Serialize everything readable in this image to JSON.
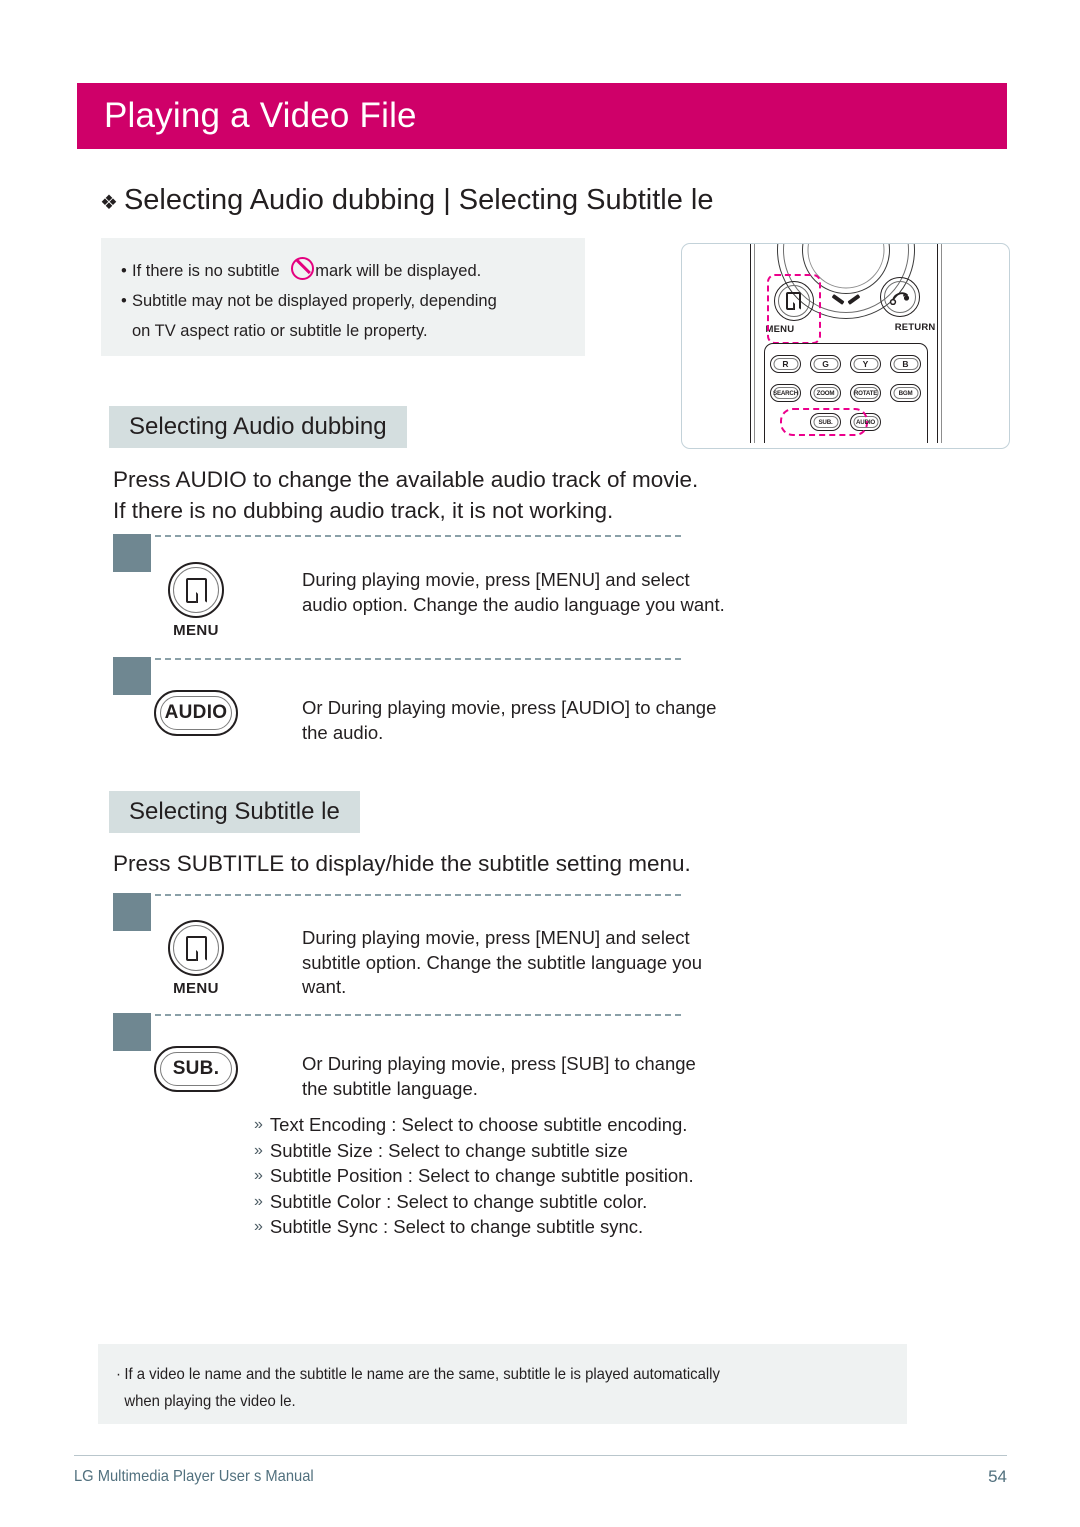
{
  "page": {
    "title": "Playing a Video File",
    "heading_bullet": "❖",
    "heading": "Selecting Audio dubbing | Selecting Subtitle  le"
  },
  "note_top": {
    "bullet": "•",
    "line1_before": "If there is no subtitle",
    "no_symbol_icon": "no-symbol-icon",
    "line1_after": "mark will be displayed.",
    "line2": "Subtitle may not be displayed properly, depending",
    "line3": "on TV aspect ratio or subtitle  le property."
  },
  "remote": {
    "menu_label": "MENU",
    "return_label": "RETURN",
    "color_keys": [
      "R",
      "G",
      "Y",
      "B"
    ],
    "function_keys": [
      "SEARCH",
      "ZOOM",
      "ROTATE",
      "BGM"
    ],
    "media_keys": [
      "SUB.",
      "AUDIO"
    ],
    "highlight_color": "#ec008c",
    "frame_border_color": "#c3d2d9"
  },
  "audio_section": {
    "chip": "Selecting Audio dubbing",
    "intro": "Press AUDIO to change the available audio track of movie.\nIf there is no dubbing audio track, it is not working.",
    "steps": [
      {
        "icon": "menu-button-icon",
        "icon_label": "MENU",
        "text": "During playing movie, press [MENU] and select\naudio option. Change the audio language you want."
      },
      {
        "icon": "audio-button-icon",
        "icon_label": "AUDIO",
        "text": "Or During playing movie, press [AUDIO] to change\nthe audio."
      }
    ]
  },
  "subtitle_section": {
    "chip": "Selecting Subtitle  le",
    "intro": "Press SUBTITLE to display/hide the subtitle setting menu.",
    "steps": [
      {
        "icon": "menu-button-icon",
        "icon_label": "MENU",
        "text": "During playing movie, press [MENU] and select\nsubtitle option. Change the subtitle language you\nwant."
      },
      {
        "icon": "sub-button-icon",
        "icon_label": "SUB.",
        "text": "Or During playing movie, press [SUB] to change\nthe subtitle language."
      }
    ],
    "options_marker": "»",
    "options": [
      "Text Encoding : Select to choose subtitle encoding.",
      "Subtitle Size : Select to change subtitle size",
      "Subtitle Position : Select to change subtitle position.",
      "Subtitle Color : Select to change subtitle color.",
      "Subtitle Sync : Select to change subtitle sync."
    ]
  },
  "note_bottom": {
    "tick": "·",
    "line1": "If a video  le name and the subtitle  le name are the same, subtitle  le is played automatically",
    "line2": "when playing the video  le."
  },
  "footer": {
    "left": "LG Multimedia Player User s Manual",
    "page_number": "54"
  },
  "colors": {
    "title_bar": "#cf0069",
    "chip_bg": "#d4dedf",
    "note_bg": "#eff2f2",
    "divider_block": "#6f8791",
    "divider_dash": "#8aa0a8",
    "footer_text": "#51707e",
    "accent_pink": "#e4007f"
  }
}
